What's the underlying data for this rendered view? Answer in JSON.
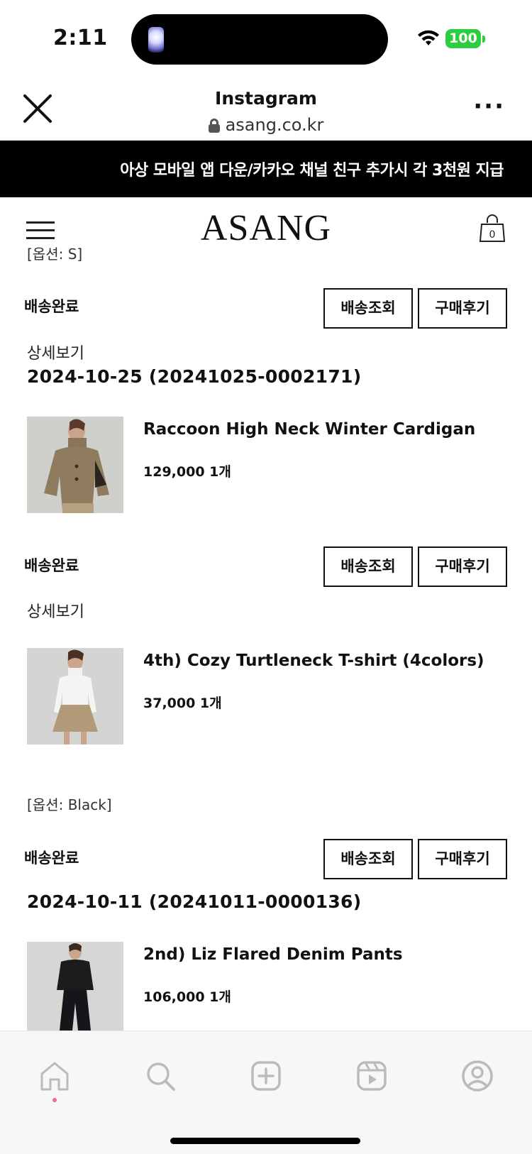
{
  "status_bar": {
    "time": "2:11",
    "battery": "100"
  },
  "browser": {
    "title": "Instagram",
    "url": "asang.co.kr"
  },
  "banner": {
    "text": "아상 모바일 앱 다운/카카오 채널 친구 추가시 각 3천원 지급"
  },
  "site": {
    "logo": "ASANG",
    "cart_count": "0"
  },
  "orders": {
    "top_option": "[옵션: S]",
    "o1": {
      "status": "배송완료",
      "track_label": "배송조회",
      "review_label": "구매후기",
      "detail_label": "상세보기",
      "date_id": "2024-10-25 (20241025-0002171)",
      "item_name": "Raccoon High Neck Winter Cardigan",
      "item_price": "129,000 1개"
    },
    "o2": {
      "status": "배송완료",
      "track_label": "배송조회",
      "review_label": "구매후기",
      "detail_label": "상세보기",
      "item_name": "4th) Cozy Turtleneck T-shirt (4colors)",
      "item_price": "37,000 1개",
      "option": "[옵션: Black]"
    },
    "o3": {
      "status": "배송완료",
      "track_label": "배송조회",
      "review_label": "구매후기",
      "date_id": "2024-10-11 (20241011-0000136)",
      "item_name": "2nd) Liz Flared Denim Pants",
      "item_price": "106,000 1개"
    }
  },
  "tabbar": {
    "icons": [
      "home-icon",
      "search-icon",
      "create-icon",
      "reels-icon",
      "profile-icon"
    ]
  },
  "colors": {
    "battery": "#2ecc40",
    "banner_bg": "#000000",
    "text": "#111111"
  }
}
